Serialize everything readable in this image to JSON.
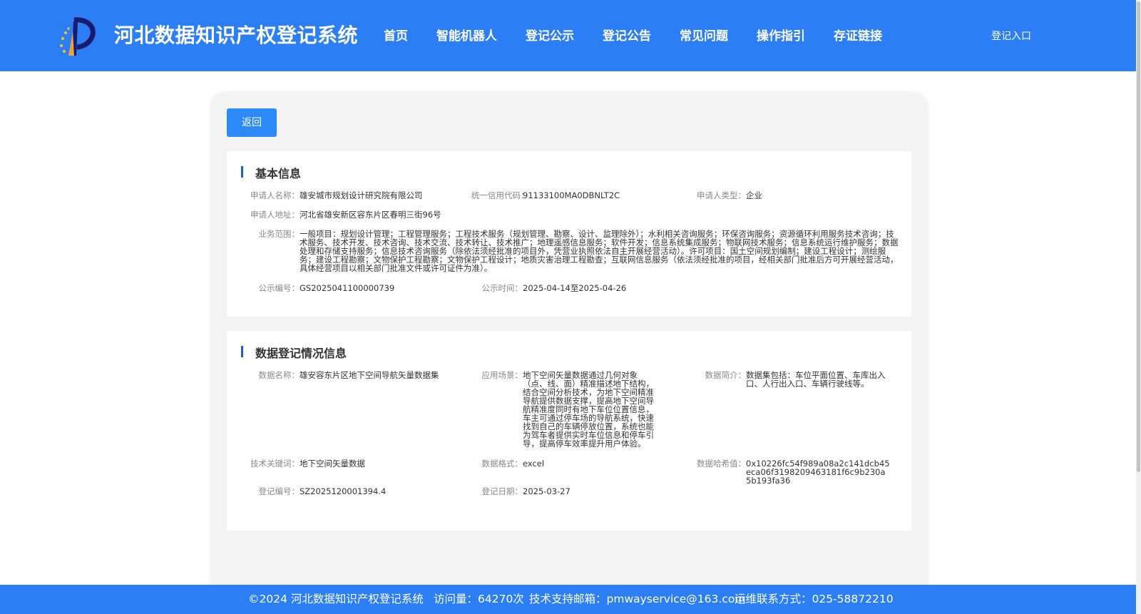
{
  "header": {
    "site_title": "河北数据知识产权登记系统",
    "nav": [
      "首页",
      "智能机器人",
      "登记公示",
      "登记公告",
      "常见问题",
      "操作指引",
      "存证链接"
    ],
    "login": "登记入口"
  },
  "back_button": "返回",
  "basic_info": {
    "title": "基本信息",
    "applicant_name": {
      "label": "申请人名称：",
      "value": "雄安城市规划设计研究院有限公司"
    },
    "credit_code": {
      "label": "统一信用代码：",
      "value": "91133100MA0DBNLT2C"
    },
    "applicant_type": {
      "label": "申请人类型：",
      "value": "企业"
    },
    "address": {
      "label": "申请人地址：",
      "value": "河北省雄安新区容东片区春明三街96号"
    },
    "business_scope": {
      "label": "业务范围：",
      "value": "一般项目：规划设计管理；工程管理服务；工程技术服务（规划管理、勘察、设计、监理除外）；水利相关咨询服务；环保咨询服务；资源循环利用服务技术咨询；技术服务、技术开发、技术咨询、技术交流、技术转让、技术推广；地理遥感信息服务；软件开发；信息系统集成服务；物联网技术服务；信息系统运行维护服务；数据处理和存储支持服务；信息技术咨询服务（除依法须经批准的项目外，凭营业执照依法自主开展经营活动）。许可项目：国土空间规划编制；建设工程设计；测绘服务；建设工程勘察；文物保护工程勘察；文物保护工程设计；地质灾害治理工程勘查；互联网信息服务（依法须经批准的项目，经相关部门批准后方可开展经营活动，具体经营项目以相关部门批准文件或许可证件为准）。"
    },
    "notice_no": {
      "label": "公示编号：",
      "value": "GS2025041100000739"
    },
    "notice_time": {
      "label": "公示时间：",
      "value": "2025-04-14至2025-04-26"
    }
  },
  "data_info": {
    "title": "数据登记情况信息",
    "data_name": {
      "label": "数据名称：",
      "value": "雄安容东片区地下空间导航矢量数据集"
    },
    "scenario": {
      "label": "应用场景：",
      "value": "地下空间矢量数据通过几何对象（点、线、面）精准描述地下结构，结合空间分析技术，为地下空间精准导航提供数据支撑，提高地下空间导航精准度同时有地下车位位置信息，车主可通过停车场的导航系统，快速找到自己的车辆停放位置，系统也能为驾车者提供实时车位信息和停车引导，提高停车效率提升用户体验。"
    },
    "summary": {
      "label": "数据简介：",
      "value": "数据集包括：车位平面位置、车库出入口、人行出入口、车辆行驶线等。"
    },
    "keywords": {
      "label": "技术关键词：",
      "value": "地下空间矢量数据"
    },
    "format": {
      "label": "数据格式：",
      "value": "excel"
    },
    "hash": {
      "label": "数据哈希值：",
      "value": "0x10226fc54f989a08a2c141dcb45eca06f3198209463181f6c9b230a5b193fa36"
    },
    "reg_no": {
      "label": "登记编号：",
      "value": "SZ2025120001394.4"
    },
    "reg_date": {
      "label": "登记日期：",
      "value": "2025-03-27"
    }
  },
  "footer": {
    "copyright": "©2024 河北数据知识产权登记系统",
    "visits": "访问量：64270次",
    "email": "技术支持邮箱：pmwayservice@163.com",
    "phone": "运维联系方式：025-58872210"
  },
  "colors": {
    "header": "#2b7ef3",
    "button": "#2b8af7",
    "accent": "#1f5fbf"
  }
}
